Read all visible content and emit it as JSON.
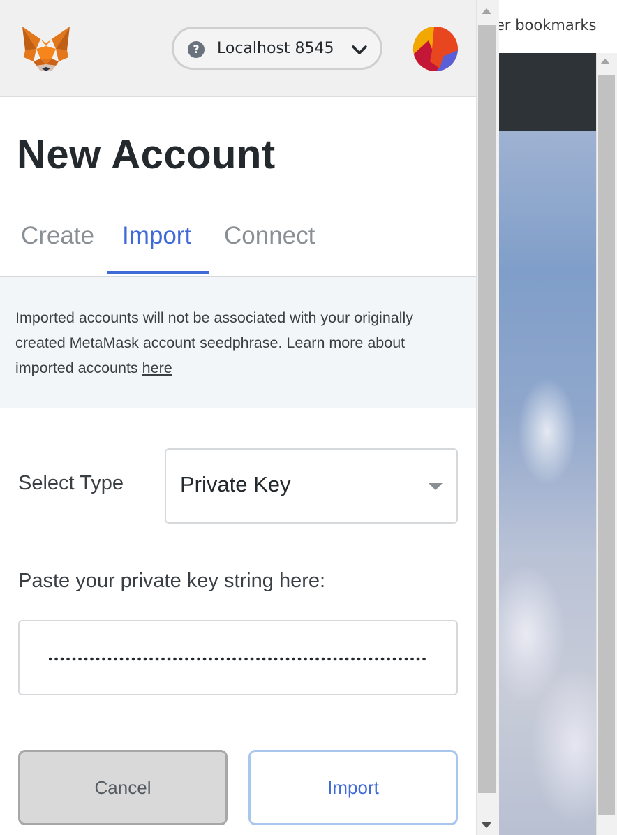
{
  "browser": {
    "bookmarks_text": "er bookmarks"
  },
  "header": {
    "logo_icon": "metamask-fox-icon",
    "network": {
      "icon": "help-circle-icon",
      "label": "Localhost 8545",
      "dropdown_icon": "chevron-down-icon"
    },
    "avatar_icon": "account-identicon"
  },
  "page": {
    "title": "New Account",
    "tabs": [
      {
        "label": "Create",
        "active": false
      },
      {
        "label": "Import",
        "active": true
      },
      {
        "label": "Connect",
        "active": false
      }
    ]
  },
  "notice": {
    "text": "Imported accounts will not be associated with your originally created MetaMask account seedphrase. Learn more about imported accounts ",
    "link_text": "here"
  },
  "form": {
    "select_type_label": "Select Type",
    "select_type_value": "Private Key",
    "private_key_label": "Paste your private key string here:",
    "private_key_masked": true
  },
  "actions": {
    "cancel_label": "Cancel",
    "import_label": "Import"
  },
  "colors": {
    "accent": "#3f6ad8",
    "header_bg": "#f0f0f0",
    "notice_bg": "#f2f6f9",
    "cancel_bg": "#d9d9d9"
  }
}
